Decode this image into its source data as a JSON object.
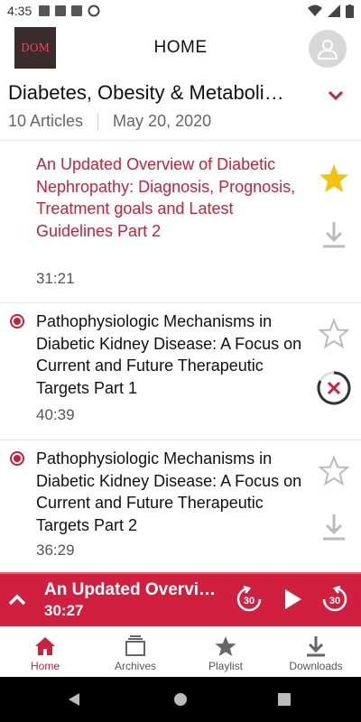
{
  "status_bar": {
    "time": "4:35"
  },
  "header": {
    "title": "HOME",
    "logo_text": "DOM"
  },
  "issue": {
    "title": "Diabetes, Obesity & Metaboli…",
    "article_count": "10 Articles",
    "date": "May 20, 2020"
  },
  "articles": [
    {
      "title": "An Updated Overview of Diabetic Nephropathy: Diagnosis, Prognosis, Treatment goals and Latest Guidelines Part 2",
      "duration": "31:21",
      "active": true,
      "favorited": true,
      "download_state": "download"
    },
    {
      "title": "Pathophysiologic Mechanisms in Diabetic Kidney Disease: A Focus on Current and Future Therapeutic Targets Part 1",
      "duration": "40:39",
      "active": false,
      "favorited": false,
      "download_state": "downloading-cancel"
    },
    {
      "title": "Pathophysiologic Mechanisms in Diabetic Kidney Disease: A Focus on Current and Future Therapeutic Targets Part 2",
      "duration": "36:29",
      "active": false,
      "favorited": false,
      "download_state": "download"
    }
  ],
  "player": {
    "title": "An Updated Overvi…",
    "time": "30:27",
    "skip_back_label": "30",
    "skip_forward_label": "30"
  },
  "nav": [
    {
      "label": "Home",
      "icon": "home-icon",
      "active": true
    },
    {
      "label": "Archives",
      "icon": "archives-icon",
      "active": false
    },
    {
      "label": "Playlist",
      "icon": "star-icon",
      "active": false
    },
    {
      "label": "Downloads",
      "icon": "download-icon",
      "active": false
    }
  ],
  "colors": {
    "accent": "#d01f3f",
    "star": "#f2c40f"
  }
}
